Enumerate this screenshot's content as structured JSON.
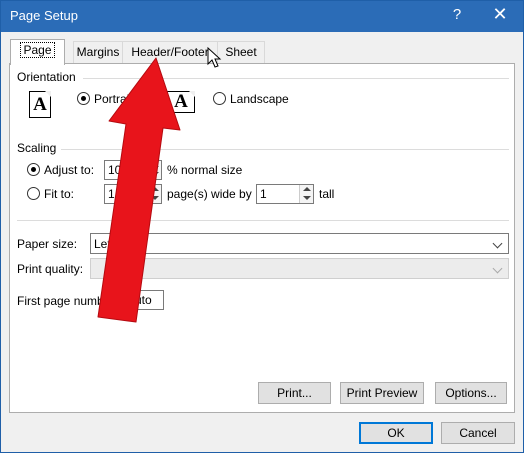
{
  "window": {
    "title": "Page Setup",
    "help_label": "?",
    "close_label": "✕"
  },
  "tabs": [
    {
      "label": "Page",
      "active": true
    },
    {
      "label": "Margins",
      "active": false
    },
    {
      "label": "Header/Footer",
      "active": false
    },
    {
      "label": "Sheet",
      "active": false
    }
  ],
  "orientation": {
    "label": "Orientation",
    "portrait_label": "Portrait",
    "landscape_label": "Landscape",
    "selected": "portrait",
    "icon_glyph": "A"
  },
  "scaling": {
    "label": "Scaling",
    "adjust_label": "Adjust to:",
    "adjust_value": "100",
    "adjust_suffix": "% normal size",
    "fit_label": "Fit to:",
    "fit_wide_value": "1",
    "fit_wide_suffix": "page(s) wide by",
    "fit_tall_value": "1",
    "fit_tall_suffix": "tall",
    "selected": "adjust"
  },
  "paper": {
    "paper_size_label": "Paper size:",
    "paper_size_value": "Letter",
    "print_quality_label": "Print quality:",
    "print_quality_value": "",
    "first_page_label": "First page number:",
    "first_page_value": "Auto"
  },
  "actions": {
    "print_label": "Print...",
    "print_preview_label": "Print Preview",
    "options_label": "Options..."
  },
  "footer": {
    "ok_label": "OK",
    "cancel_label": "Cancel"
  },
  "colors": {
    "titlebar": "#2b6cb7",
    "annotation_arrow": "#e8141b",
    "default_button_border": "#0078d7"
  },
  "icons": {
    "help": "question-mark-icon",
    "close": "close-icon",
    "cursor": "mouse-pointer-icon"
  }
}
